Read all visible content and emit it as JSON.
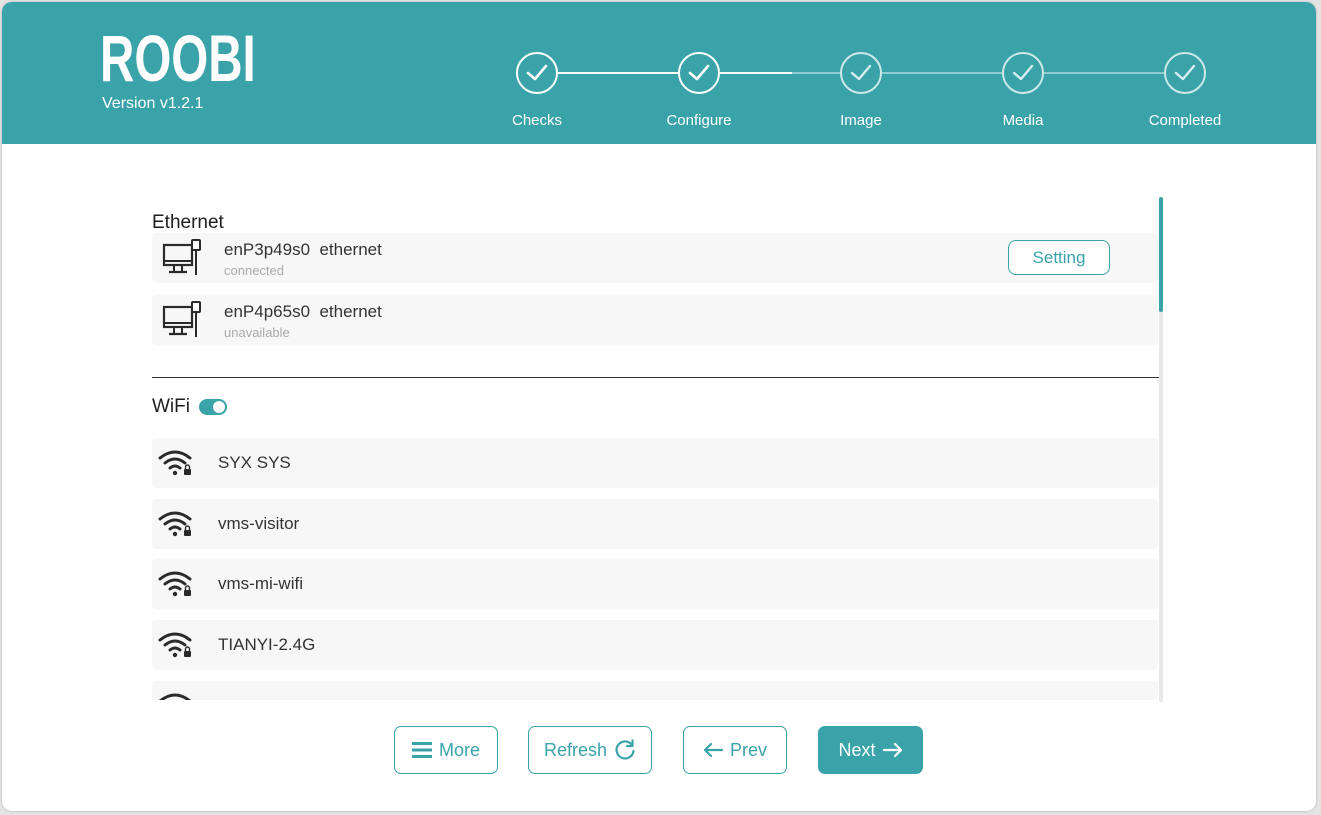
{
  "app": {
    "logo": "ROOBI",
    "version": "Version v1.2.1"
  },
  "steps": [
    {
      "label": "Checks",
      "completed": true
    },
    {
      "label": "Configure",
      "completed": true
    },
    {
      "label": "Image",
      "completed": false
    },
    {
      "label": "Media",
      "completed": false
    },
    {
      "label": "Completed",
      "completed": false
    }
  ],
  "ethernet": {
    "title": "Ethernet",
    "interfaces": [
      {
        "name": "enP3p49s0  ethernet",
        "status": "connected",
        "action": "Setting"
      },
      {
        "name": "enP4p65s0  ethernet",
        "status": "unavailable"
      }
    ]
  },
  "wifi": {
    "title": "WiFi",
    "enabled": true,
    "networks": [
      {
        "ssid": "SYX SYS",
        "secured": true
      },
      {
        "ssid": "vms-visitor",
        "secured": true
      },
      {
        "ssid": "vms-mi-wifi",
        "secured": true
      },
      {
        "ssid": "TIANYI-2.4G",
        "secured": true
      },
      {
        "ssid": "",
        "secured": true
      }
    ]
  },
  "buttons": {
    "more": "More",
    "refresh": "Refresh",
    "prev": "Prev",
    "next": "Next"
  },
  "icons": {
    "menu": "menu-icon",
    "refresh": "refresh-icon",
    "prev": "arrow-left-icon",
    "next": "arrow-right-icon",
    "step": "check-icon",
    "ethernet": "ethernet-computer-icon",
    "wifi": "wifi-lock-icon"
  },
  "colors": {
    "accent": "#3aa3a9",
    "background": "#ffffff",
    "row": "#f7f7f7"
  }
}
